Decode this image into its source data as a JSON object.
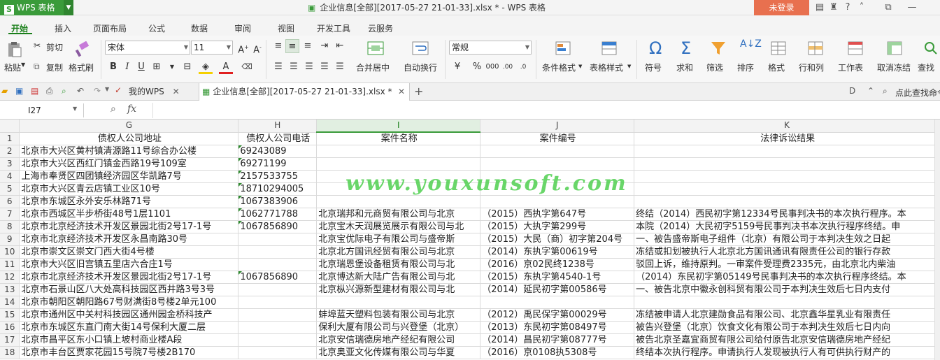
{
  "titlebar": {
    "app_name": "WPS 表格",
    "window_title": "企业信息[全部][2017-05-27 21-01-33].xlsx * - WPS 表格",
    "login_label": "未登录"
  },
  "ribbon_tabs": [
    "开始",
    "插入",
    "页面布局",
    "公式",
    "数据",
    "审阅",
    "视图",
    "开发工具",
    "云服务"
  ],
  "ribbon": {
    "paste": "粘贴",
    "cut": "剪切",
    "copy": "复制",
    "format_painter": "格式刷",
    "font_name": "宋体",
    "font_size": "11",
    "number_format": "常规",
    "merge_center": "合并居中",
    "wrap_text": "自动换行",
    "conditional_format": "条件格式",
    "table_style": "表格样式",
    "symbol": "符号",
    "sum": "求和",
    "filter": "筛选",
    "sort": "排序",
    "format": "格式",
    "row_col": "行和列",
    "worksheet": "工作表",
    "freeze": "取消冻结",
    "find": "查找"
  },
  "doctabs": {
    "my_wps": "我的WPS",
    "file_tab": "企业信息[全部][2017-05-27 21-01-33].xlsx *",
    "search_cmd": "点此查找命令"
  },
  "formula_bar": {
    "name_box": "I27",
    "fx": "fx",
    "formula": ""
  },
  "sheet": {
    "columns": [
      "G",
      "H",
      "I",
      "J",
      "K"
    ],
    "rows": [
      {
        "n": "1",
        "cells": [
          "债权人公司地址",
          "债权人公司电话",
          "案件名称",
          "案件编号",
          "法律诉讼结果"
        ]
      },
      {
        "n": "2",
        "cells": [
          "北京市大兴区黄村镇清源路11号综合办公楼",
          "69243089",
          "",
          "",
          ""
        ]
      },
      {
        "n": "3",
        "cells": [
          "北京市大兴区西红门镇金西路19号109室",
          "69271199",
          "",
          "",
          ""
        ]
      },
      {
        "n": "4",
        "cells": [
          "上海市奉贤区四团镇经济园区华凯路7号",
          "2157533755",
          "",
          "",
          ""
        ]
      },
      {
        "n": "5",
        "cells": [
          "北京市大兴区青云店镇工业区10号",
          "18710294005",
          "",
          "",
          ""
        ]
      },
      {
        "n": "6",
        "cells": [
          "北京市东城区永外安乐林路71号",
          "1067383906",
          "",
          "",
          ""
        ]
      },
      {
        "n": "7",
        "cells": [
          "北京市西城区半步桥街48号1层1101",
          "1062771788",
          "北京瑞邦和元商贸有限公司与北京",
          "（2015）西执字第647号",
          "终结（2014）西民初字第12334号民事判决书的本次执行程序。本"
        ]
      },
      {
        "n": "8",
        "cells": [
          "北京市北京经济技术开发区景园北街2号17-1号",
          "1067856890",
          "北京宝木天润展览展示有限公司与北",
          "（2015）大执字第299号",
          "本院（2014）大民初字5159号民事判决书本次执行程序终结。申"
        ]
      },
      {
        "n": "9",
        "cells": [
          "北京市北京经济技术开发区永昌南路30号",
          "",
          "北京宝优际电子有限公司与盛帝斯",
          "（2015）大民（商）初字第204号",
          "一、被告盛帝斯电子组件（北京）有限公司于本判决生效之日起"
        ]
      },
      {
        "n": "10",
        "cells": [
          "北京市崇文区崇文门西大街4号楼",
          "",
          "北京北方国讯经贸有限公司与北京",
          "（2014）东执字第00619号",
          "冻结或扣划被执行人北京北方国讯通讯有限责任公司的银行存款"
        ]
      },
      {
        "n": "11",
        "cells": [
          "北京市大兴区旧宫镇五里店六合庄1号",
          "",
          "北京瑞恩堡设备租赁有限公司与北",
          "（2016）京02民终1238号",
          "驳回上诉，维持原判。一审案件受理费2335元，由北京北内柴油"
        ]
      },
      {
        "n": "12",
        "cells": [
          "北京市北京经济技术开发区景园北街2号17-1号",
          "1067856890",
          "北京博达新大陆广告有限公司与北",
          "（2015）东执字第4540-1号",
          "（2014）东民初字第05149号民事判决书的本次执行程序终结。本"
        ]
      },
      {
        "n": "13",
        "cells": [
          "北京市石景山区八大处高科技园区西井路3号3号",
          "",
          "北京枞兴源新型建材有限公司与北",
          "（2014）延民初字第00586号",
          "一、被告北京中徽永创科贸有限公司于本判决生效后七日内支付"
        ]
      },
      {
        "n": "14",
        "cells": [
          "北京市朝阳区朝阳路67号财满街8号楼2单元100",
          "",
          "",
          "",
          ""
        ]
      },
      {
        "n": "15",
        "cells": [
          "北京市通州区中关村科技园区通州园金桥科技产",
          "",
          "蚌埠蓝天塑料包装有限公司与北京",
          "（2012）禹民保字第00029号",
          "冻结被申请人北京建勋食品有限公司、北京鑫华星乳业有限责任"
        ]
      },
      {
        "n": "16",
        "cells": [
          "北京市东城区东直门南大街14号保利大厦二层",
          "",
          "保利大厦有限公司与兴登堡（北京）",
          "（2013）东民初字第08497号",
          "被告兴登堡（北京）饮食文化有限公司于本判决生效后七日内向"
        ]
      },
      {
        "n": "17",
        "cells": [
          "北京市昌平区东小口镇上坡村商业楼A段",
          "",
          "北京安信瑞德房地产经纪有限公司",
          "（2014）昌民初字第08777号",
          "被告北京圣嘉宜商贸有限公司给付原告北京安信瑞德房地产经纪"
        ]
      },
      {
        "n": "18",
        "cells": [
          "北京市丰台区贾家花园15号院7号楼2B170",
          "",
          "北京奥亚文化传媒有限公司与华夏",
          "（2016）京0108执5308号",
          "终结本次执行程序。申请执行人发现被执行人有可供执行财产的"
        ]
      }
    ]
  },
  "watermark": "www.youxunsoft.com"
}
